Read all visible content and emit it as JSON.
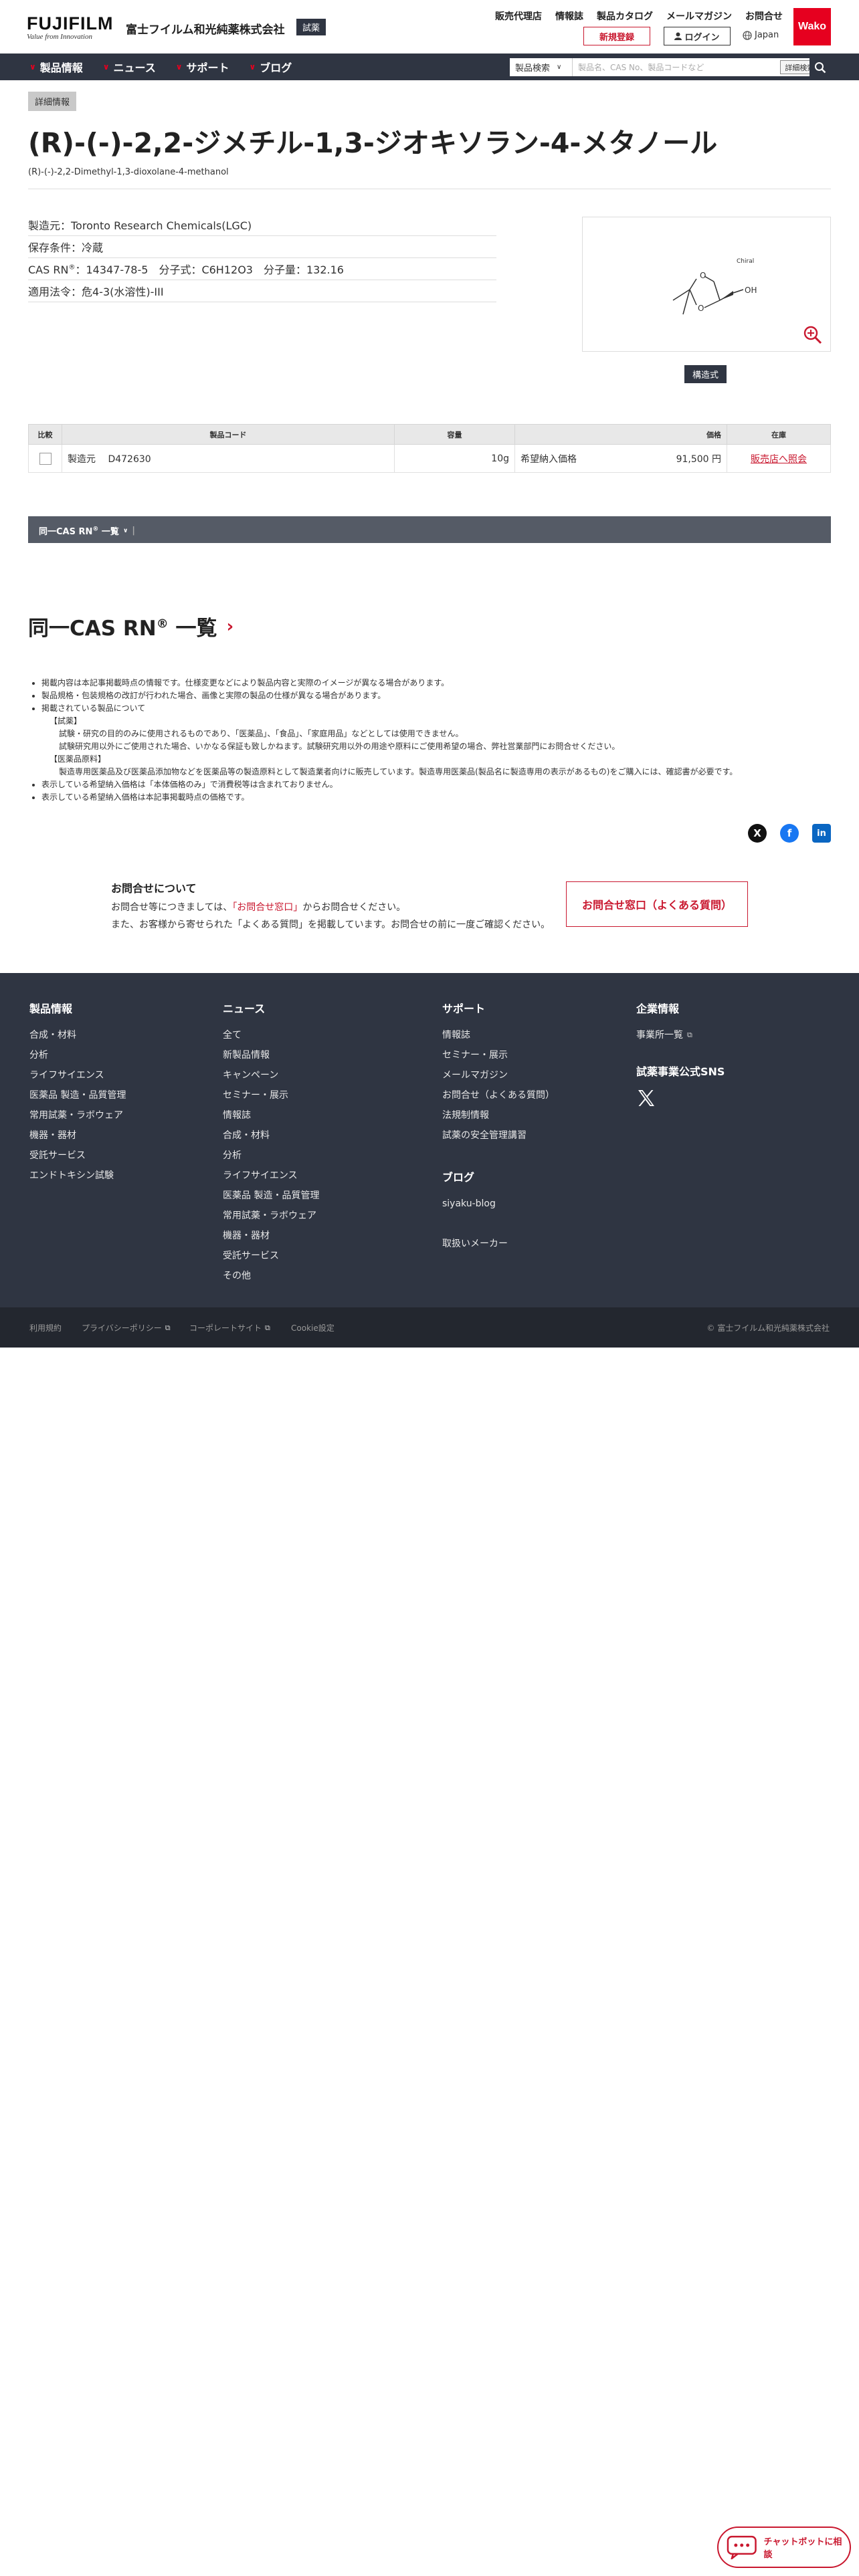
{
  "header": {
    "logo_text": "FUJIFILM",
    "logo_tagline": "Value from Innovation",
    "company_name": "富士フイルム和光純薬株式会社",
    "company_tag": "試薬",
    "top_links": [
      "販売代理店",
      "情報誌",
      "製品カタログ",
      "メールマガジン",
      "お問合せ"
    ],
    "register_label": "新規登録",
    "login_label": "ログイン",
    "language": "Japan",
    "wako_logo": "Wako"
  },
  "nav": {
    "items": [
      "製品情報",
      "ニュース",
      "サポート",
      "ブログ"
    ],
    "search_select": "製品検索",
    "search_placeholder": "製品名、CAS No、製品コードなど",
    "detail_search": "詳細検索"
  },
  "product": {
    "badge": "詳細情報",
    "title": "(R)-(-)-2,2-ジメチル-1,3-ジオキソラン-4-メタノール",
    "subtitle": "(R)-(-)-2,2-Dimethyl-1,3-dioxolane-4-methanol",
    "manufacturer": "製造元：Toronto Research Chemicals(LGC)",
    "storage": "保存条件：冷蔵",
    "cas_label": "CAS RN",
    "cas_sup": "®",
    "cas_value": "：14347-78-5",
    "formula": "分子式：C6H12O3",
    "weight": "分子量：132.16",
    "law": "適用法令：危4-3(水溶性)-III",
    "structure_label": "構造式",
    "structure_atoms": {
      "oh": "OH",
      "chiral": "Chiral",
      "o1": "O",
      "o2": "O"
    }
  },
  "table": {
    "headers": [
      "比較",
      "製品コード",
      "容量",
      "価格",
      "在庫"
    ],
    "rows": [
      {
        "maker": "製造元",
        "code": "D472630",
        "size": "10g",
        "price_label": "希望納入価格",
        "price": "91,500 円",
        "stock": "販売店へ照会"
      }
    ]
  },
  "same_cas": {
    "bar_label": "同一CAS RN",
    "bar_sup": "®",
    "bar_suffix": "一覧",
    "heading": "同一CAS RN",
    "heading_sup": "®",
    "heading_suffix": "一覧"
  },
  "notes": {
    "n1": "掲載内容は本記事掲載時点の情報です。仕様変更などにより製品内容と実際のイメージが異なる場合があります。",
    "n2": "製品規格・包装規格の改訂が行われた場合、画像と実際の製品の仕様が異なる場合があります。",
    "n3": "掲載されている製品について",
    "n3a": "【試薬】",
    "n3b": "試験・研究の目的のみに使用されるものであり、「医薬品」、「食品」、「家庭用品」などとしては使用できません。",
    "n3c": "試験研究用以外にご使用された場合、いかなる保証も致しかねます。試験研究用以外の用途や原料にご使用希望の場合、弊社営業部門にお問合せください。",
    "n3d": "【医薬品原料】",
    "n3e": "製造専用医薬品及び医薬品添加物などを医薬品等の製造原料として製造業者向けに販売しています。製造専用医薬品(製品名に製造専用の表示があるもの)をご購入には、確認書が必要です。",
    "n4": "表示している希望納入価格は「本体価格のみ」で消費税等は含まれておりません。",
    "n5": "表示している希望納入価格は本記事掲載時点の価格です。"
  },
  "social": {
    "x_icon": "X",
    "facebook_icon": "f",
    "linkedin_icon": "in"
  },
  "contact": {
    "title": "お問合せについて",
    "line1_pre": "お問合せ等につきましては、",
    "line1_link": "「お問合せ窓口」",
    "line1_post": "からお問合せください。",
    "line2": "また、お客様から寄せられた「よくある質問」を掲載しています。お問合せの前に一度ご確認ください。",
    "button": "お問合せ窓口（よくある質問）"
  },
  "footer": {
    "col1": {
      "title": "製品情報",
      "items": [
        "合成・材料",
        "分析",
        "ライフサイエンス",
        "医薬品 製造・品質管理",
        "常用試薬・ラボウェア",
        "機器・器材",
        "受託サービス",
        "エンドトキシン試験"
      ]
    },
    "col2": {
      "title": "ニュース",
      "items": [
        "全て",
        "新製品情報",
        "キャンペーン",
        "セミナー・展示",
        "情報誌",
        "合成・材料",
        "分析",
        "ライフサイエンス",
        "医薬品 製造・品質管理",
        "常用試薬・ラボウェア",
        "機器・器材",
        "受託サービス",
        "その他"
      ]
    },
    "col3": {
      "title": "サポート",
      "items": [
        "情報誌",
        "セミナー・展示",
        "メールマガジン",
        "お問合せ（よくある質問）",
        "法規制情報",
        "試薬の安全管理講習"
      ]
    },
    "col3b": {
      "title": "ブログ",
      "items": [
        "siyaku-blog"
      ],
      "extra": "取扱いメーカー"
    },
    "col4": {
      "title": "企業情報",
      "items": [
        "事業所一覧"
      ],
      "sns_title": "試薬事業公式SNS"
    },
    "bottom_links": [
      "利用規約",
      "プライバシーポリシー",
      "コーポレートサイト",
      "Cookie設定"
    ],
    "copyright": "© 富士フイルム和光純薬株式会社"
  },
  "chatbot": {
    "label": "チャットボットに相談"
  },
  "colors": {
    "brand_red": "#c9182f",
    "nav_dark": "#2f3542",
    "wako_red": "#e6001f"
  }
}
